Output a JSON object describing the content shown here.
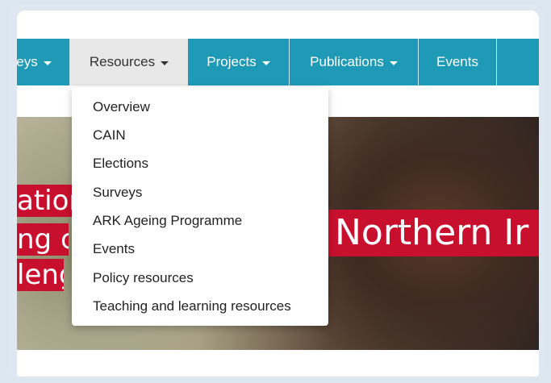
{
  "nav": {
    "items": [
      {
        "label": "eys",
        "has_caret": true
      },
      {
        "label": "Resources",
        "has_caret": true,
        "active": true
      },
      {
        "label": "Projects",
        "has_caret": true
      },
      {
        "label": "Publications",
        "has_caret": true
      },
      {
        "label": "Events",
        "has_caret": false
      }
    ]
  },
  "dropdown": {
    "items": [
      "Overview",
      "CAIN",
      "Elections",
      "Surveys",
      "ARK Ageing Programme",
      "Events",
      "Policy resources",
      "Teaching and learning resources"
    ]
  },
  "hero": {
    "banner_left": [
      "ation",
      "ng c",
      "leng"
    ],
    "banner_right": "Northern Ir"
  },
  "colors": {
    "nav_bg": "#1e9ab6",
    "nav_active_bg": "#e8e8e8",
    "banner_red": "#c8102e"
  }
}
